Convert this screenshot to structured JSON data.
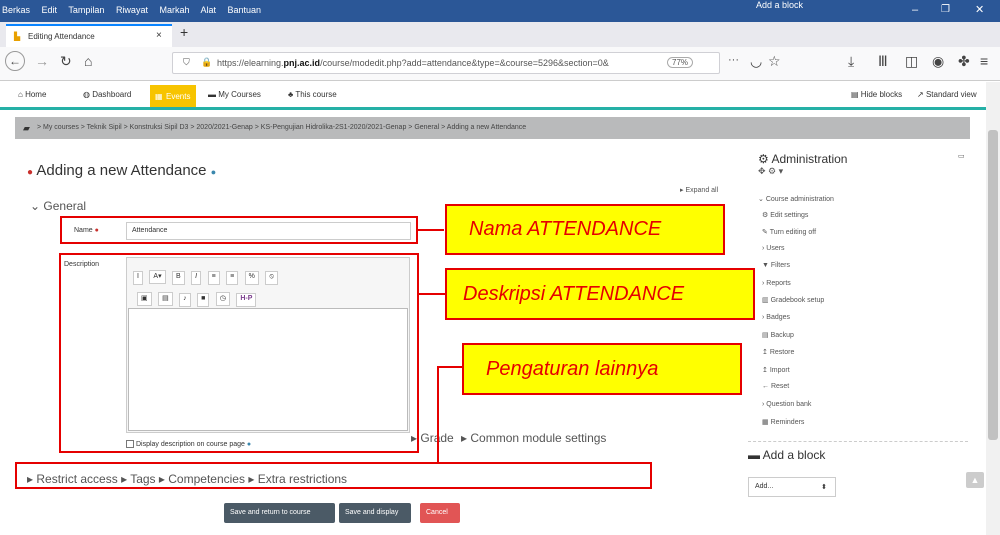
{
  "window": {
    "menu": [
      "Berkas",
      "Edit",
      "Tampilan",
      "Riwayat",
      "Markah",
      "Alat",
      "Bantuan"
    ],
    "add_block_top": "Add a block"
  },
  "tab": {
    "title": "Editing Attendance"
  },
  "url": {
    "prefix": "https://elearning.",
    "domain": "pnj.ac.id",
    "path": "/course/modedit.php?add=attendance&type=&course=5296&section=0&",
    "zoom": "77%"
  },
  "moodle_nav": {
    "home": "Home",
    "dashboard": "Dashboard",
    "events": "Events",
    "my_courses": "My Courses",
    "this_course": "This course",
    "hide_blocks": "Hide blocks",
    "standard_view": "Standard view"
  },
  "breadcrumb": "> My courses > Teknik Sipil > Konstruksi Sipil D3 > 2020/2021-Genap > KS-Pengujian Hidrolika-2S1-2020/2021-Genap > General > Adding a new Attendance",
  "page": {
    "title": "Adding a new Attendance",
    "expand_all": "Expand all",
    "general": "General",
    "name_label": "Name",
    "name_value": "Attendance",
    "description_label": "Description",
    "display_desc": "Display description on course page",
    "grade": "Grade",
    "common": "Common module settings",
    "restrict": "Restrict access",
    "tags": "Tags",
    "competencies": "Competencies",
    "extra": "Extra restrictions",
    "btn_save_return": "Save and return to course",
    "btn_save_display": "Save and display",
    "btn_cancel": "Cancel"
  },
  "editor_toolbar": {
    "row1": [
      "I",
      "A▾",
      "B",
      "I",
      "≡",
      "≡",
      "%",
      "⦸"
    ],
    "row2": [
      "▣",
      "▤",
      "♪",
      "■",
      "◷",
      "H-P"
    ]
  },
  "callouts": {
    "nama": "Nama ATTENDANCE",
    "deskripsi": "Deskripsi ATTENDANCE",
    "pengaturan": "Pengaturan lainnya"
  },
  "sidebar": {
    "title": "Administration",
    "course_admin": "Course administration",
    "items": [
      "Edit settings",
      "Turn editing off",
      "Users",
      "Filters",
      "Reports",
      "Gradebook setup",
      "Badges",
      "Backup",
      "Restore",
      "Import",
      "Reset",
      "Question bank",
      "Reminders"
    ],
    "add_block": "Add a block",
    "add_select": "Add..."
  },
  "colors": {
    "accent_teal": "#25b0a6",
    "events_yellow": "#f7c400",
    "annotation_red": "#e50000",
    "callout_yellow": "#ffff00",
    "btn_dark": "#4b5a66",
    "btn_cancel": "#e15555"
  }
}
